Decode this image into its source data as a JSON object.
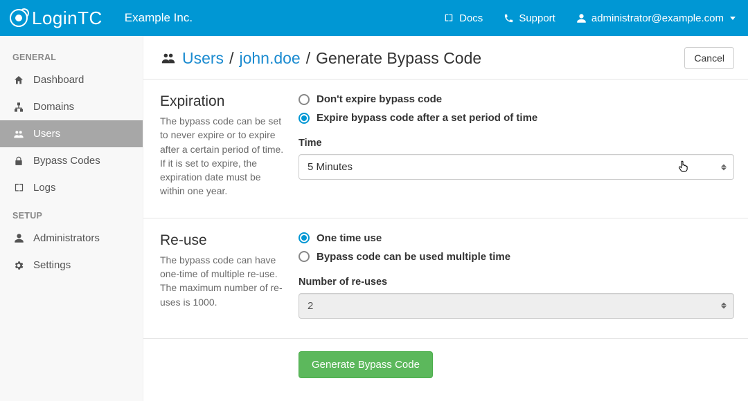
{
  "brand": "LoginTC",
  "org_name": "Example Inc.",
  "topnav": {
    "docs": "Docs",
    "support": "Support",
    "user": "administrator@example.com"
  },
  "sidebar": {
    "sections": [
      {
        "title": "GENERAL",
        "items": [
          {
            "label": "Dashboard",
            "icon": "home-icon"
          },
          {
            "label": "Domains",
            "icon": "sitemap-icon"
          },
          {
            "label": "Users",
            "icon": "users-icon",
            "active": true
          },
          {
            "label": "Bypass Codes",
            "icon": "lock-icon"
          },
          {
            "label": "Logs",
            "icon": "book-icon"
          }
        ]
      },
      {
        "title": "SETUP",
        "items": [
          {
            "label": "Administrators",
            "icon": "user-icon"
          },
          {
            "label": "Settings",
            "icon": "gears-icon"
          }
        ]
      }
    ]
  },
  "breadcrumb": {
    "root": "Users",
    "user": "john.doe",
    "page": "Generate Bypass Code"
  },
  "buttons": {
    "cancel": "Cancel",
    "generate": "Generate Bypass Code"
  },
  "expiration": {
    "title": "Expiration",
    "description": "The bypass code can be set to never expire or to expire after a certain period of time. If it is set to expire, the expiration date must be within one year.",
    "options": {
      "never": "Don't expire bypass code",
      "after": "Expire bypass code after a set period of time"
    },
    "selected": "after",
    "time_label": "Time",
    "time_value": "5 Minutes"
  },
  "reuse": {
    "title": "Re-use",
    "description": "The bypass code can have one-time of multiple re-use. The maximum number of re-uses is 1000.",
    "options": {
      "once": "One time use",
      "multi": "Bypass code can be used multiple time"
    },
    "selected": "once",
    "count_label": "Number of re-uses",
    "count_value": "2"
  }
}
